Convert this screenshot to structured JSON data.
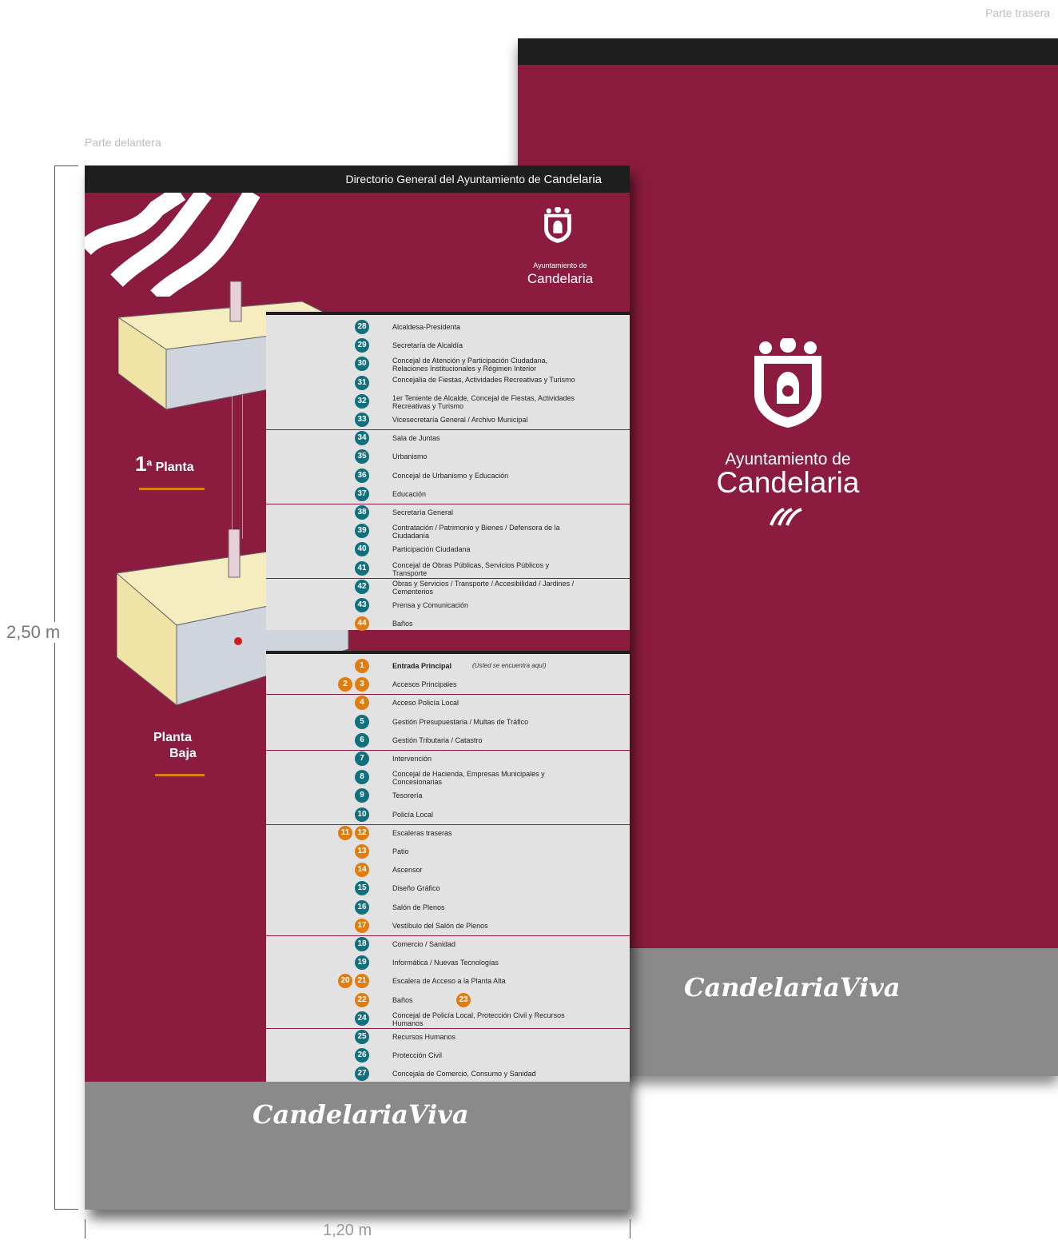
{
  "labels": {
    "back": "Parte trasera",
    "front": "Parte delantera",
    "height": "2,50 m",
    "width": "1,20 m"
  },
  "front": {
    "header_prefix": "Directorio General del Ayuntamiento de ",
    "header_bold": "Candelaria",
    "logo_line1": "Ayuntamiento de",
    "logo_line2": "Candelaria",
    "floor1_sup": "a",
    "floor1_num": "1",
    "floor1_word": "Planta",
    "floor0_line1": "Planta",
    "floor0_line2": "Baja",
    "footer_brand_a": "Candelaria",
    "footer_brand_b": "Viva"
  },
  "back": {
    "logo_line1": "Ayuntamiento de",
    "logo_line2": "Candelaria",
    "footer_brand_a": "Candelaria",
    "footer_brand_b": "Viva"
  },
  "directory_upper": [
    {
      "n": "28",
      "c": "teal",
      "t": "Alcaldesa-Presidenta"
    },
    {
      "n": "29",
      "c": "teal",
      "t": "Secretaría de Alcaldía"
    },
    {
      "n": "30",
      "c": "teal",
      "t": "Concejal de Atención y Participación Ciudadana, Relaciones Institucionales y Régimen Interior"
    },
    {
      "n": "31",
      "c": "teal",
      "t": "Concejalía de Fiestas, Actividades Recreativas y Turismo"
    },
    {
      "n": "32",
      "c": "teal",
      "t": "1er Teniente de Alcalde, Concejal de Fiestas, Actividades Recreativas y Turismo"
    },
    {
      "n": "33",
      "c": "teal",
      "t": "Vicesecretaría General / Archivo Municipal"
    },
    {
      "n": "34",
      "c": "teal",
      "t": "Sala de Juntas"
    },
    {
      "n": "35",
      "c": "teal",
      "t": "Urbanismo"
    },
    {
      "n": "36",
      "c": "teal",
      "t": "Concejal de Urbanismo y Educación"
    },
    {
      "n": "37",
      "c": "teal",
      "t": "Educación"
    },
    {
      "n": "38",
      "c": "teal",
      "t": "Secretaría General"
    },
    {
      "n": "39",
      "c": "teal",
      "t": "Contratación / Patrimonio y Bienes / Defensora de la Ciudadanía"
    },
    {
      "n": "40",
      "c": "teal",
      "t": "Participación Ciudadana"
    },
    {
      "n": "41",
      "c": "teal",
      "t": "Concejal de Obras Públicas, Servicios Públicos y Transporte"
    },
    {
      "n": "42",
      "c": "teal",
      "t": "Obras y Servicios / Transporte / Accesibilidad / Jardines / Cementerios"
    },
    {
      "n": "43",
      "c": "teal",
      "t": "Prensa y Comunicación"
    },
    {
      "n": "44",
      "c": "orange",
      "t": "Baños"
    }
  ],
  "directory_lower": [
    {
      "n": "1",
      "c": "orange",
      "t": "Entrada Principal",
      "note": "(Usted se encuentra aquí)"
    },
    {
      "n": "3",
      "n2": "2",
      "c": "orange",
      "t": "Accesos Principales"
    },
    {
      "n": "4",
      "c": "orange",
      "t": "Acceso Policía Local"
    },
    {
      "n": "5",
      "c": "teal",
      "t": "Gestión Presupuestaria / Multas de Tráfico"
    },
    {
      "n": "6",
      "c": "teal",
      "t": "Gestión Tributaria / Catastro"
    },
    {
      "n": "7",
      "c": "teal",
      "t": "Intervención"
    },
    {
      "n": "8",
      "c": "teal",
      "t": "Concejal de Hacienda, Empresas Municipales y Concesionarias"
    },
    {
      "n": "9",
      "c": "teal",
      "t": "Tesorería"
    },
    {
      "n": "10",
      "c": "teal",
      "t": "Policía Local"
    },
    {
      "n": "12",
      "n2": "11",
      "c": "orange",
      "t": "Escaleras traseras"
    },
    {
      "n": "13",
      "c": "orange",
      "t": "Patio"
    },
    {
      "n": "14",
      "c": "orange",
      "t": "Ascensor"
    },
    {
      "n": "15",
      "c": "teal",
      "t": "Diseño Gráfico"
    },
    {
      "n": "16",
      "c": "teal",
      "t": "Salón de Plenos"
    },
    {
      "n": "17",
      "c": "orange",
      "t": "Vestíbulo del Salón de Plenos"
    },
    {
      "n": "18",
      "c": "teal",
      "t": "Comercio / Sanidad"
    },
    {
      "n": "19",
      "c": "teal",
      "t": "Informática / Nuevas Tecnologías"
    },
    {
      "n": "21",
      "n2": "20",
      "c": "orange",
      "t": "Escalera de Acceso a la Planta Alta"
    },
    {
      "n": "22",
      "c": "orange",
      "t": "Baños",
      "extra": "23"
    },
    {
      "n": "24",
      "c": "teal",
      "t": "Concejal de Policía Local, Protección Civil y Recursos Humanos"
    },
    {
      "n": "25",
      "c": "teal",
      "t": "Recursos Humanos"
    },
    {
      "n": "26",
      "c": "teal",
      "t": "Protección Civil"
    },
    {
      "n": "27",
      "c": "teal",
      "t": "Concejala de Comercio, Consumo y Sanidad"
    }
  ],
  "colors": {
    "maroon": "#8b1c3f",
    "teal": "#11707e",
    "orange": "#e07d10",
    "gray": "#8a8a8a",
    "dark": "#1e1e1e"
  }
}
